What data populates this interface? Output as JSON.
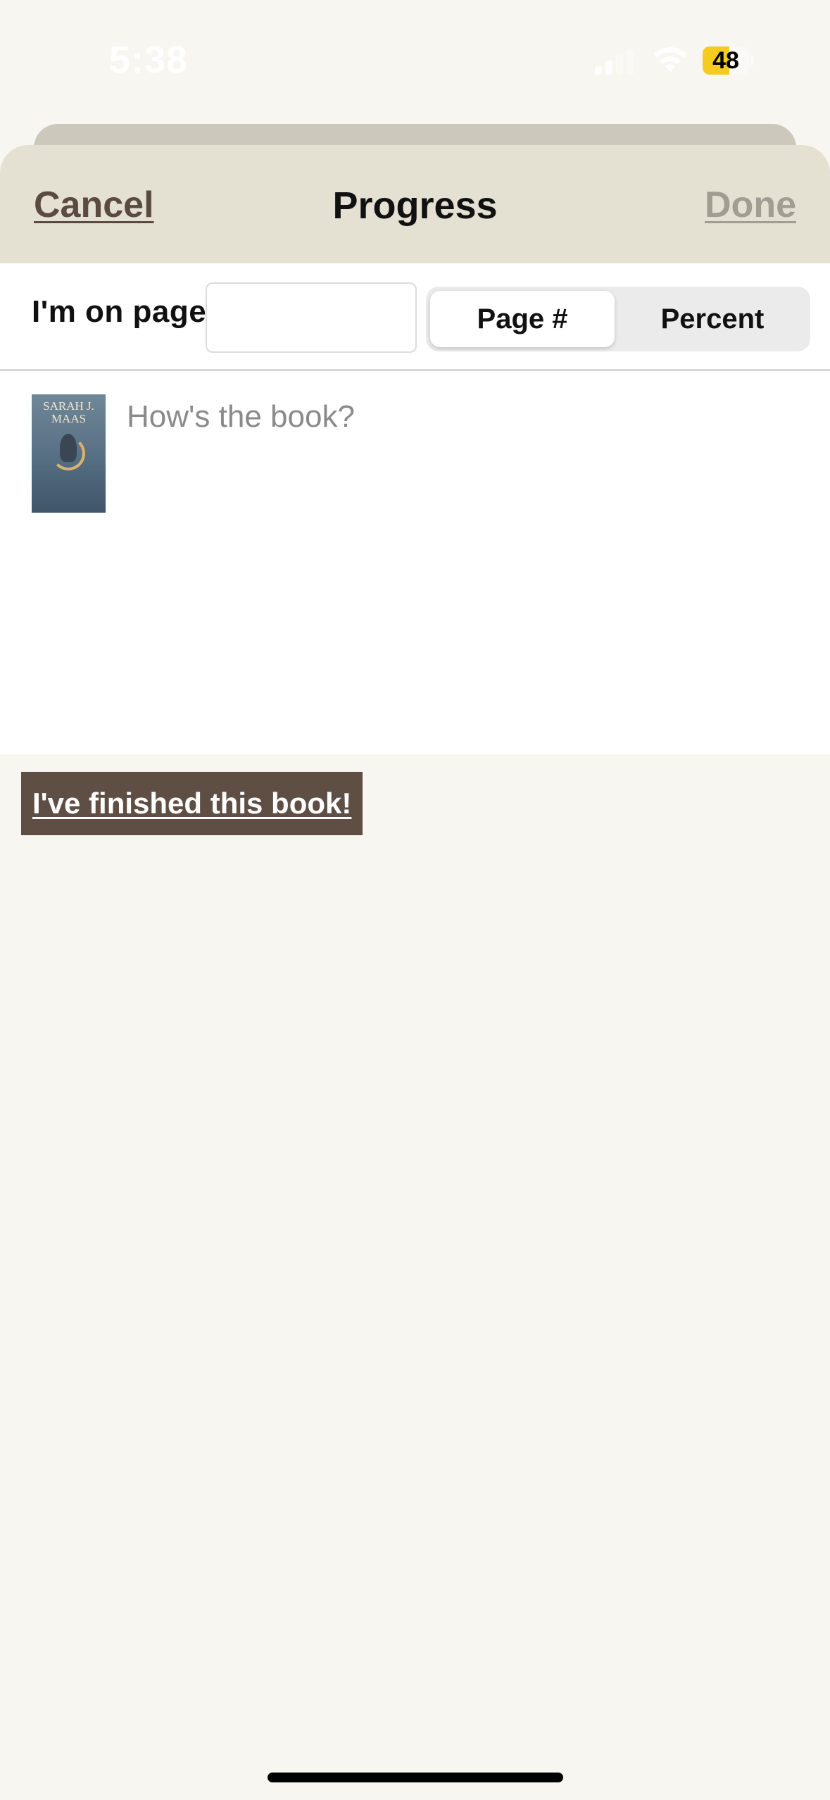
{
  "status_bar": {
    "time": "5:38",
    "battery_level": "48",
    "battery_color": "#f5cb1d"
  },
  "nav": {
    "cancel_label": "Cancel",
    "title": "Progress",
    "done_label": "Done"
  },
  "progress": {
    "label": "I'm on page",
    "page_value": "",
    "segments": [
      {
        "label": "Page #",
        "selected": true
      },
      {
        "label": "Percent",
        "selected": false
      }
    ]
  },
  "comment": {
    "placeholder": "How's the book?",
    "value": ""
  },
  "book": {
    "cover_author_line1": "SARAH J.",
    "cover_author_line2": "MAAS"
  },
  "actions": {
    "finished_label": "I've finished this book!"
  },
  "colors": {
    "background": "#f7f6f0",
    "nav_background": "#e4e1d3",
    "accent_brown": "#5f4e43",
    "done_disabled": "#a29d93"
  },
  "icons": {
    "signal": "cellular-signal-icon",
    "wifi": "wifi-icon",
    "battery": "battery-icon"
  }
}
